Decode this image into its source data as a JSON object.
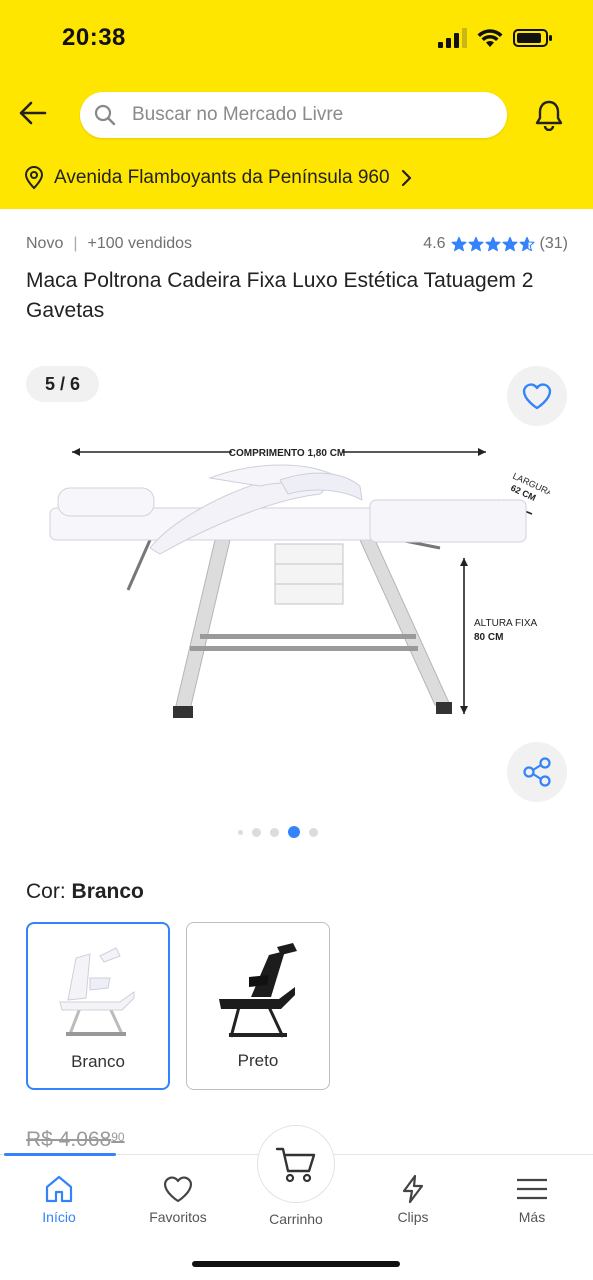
{
  "status_bar": {
    "time": "20:38"
  },
  "search": {
    "placeholder": "Buscar no Mercado Livre"
  },
  "address": {
    "text": "Avenida Flamboyants da Península 960"
  },
  "product": {
    "condition": "Novo",
    "sold": "+100 vendidos",
    "rating": "4.6",
    "rating_stars": 4.6,
    "review_count": "(31)",
    "title": "Maca Poltrona Cadeira Fixa Luxo Estética Tatuagem 2 Gavetas",
    "old_price": "R$ 4.068",
    "old_price_cents": "90"
  },
  "gallery": {
    "counter": "5 / 6",
    "image_labels": {
      "length": "COMPRIMENTO 1,80 CM",
      "width_label": "LARGURA",
      "width_value": "62 CM",
      "height_label": "ALTURA FIXA",
      "height_value": "80 CM"
    }
  },
  "color_selector": {
    "label": "Cor:",
    "selected": "Branco",
    "options": [
      {
        "label": "Branco"
      },
      {
        "label": "Preto"
      }
    ]
  },
  "bottom_nav": {
    "items": [
      {
        "label": "Início",
        "icon": "home-icon"
      },
      {
        "label": "Favoritos",
        "icon": "heart-icon"
      },
      {
        "label": "Carrinho",
        "icon": "cart-icon"
      },
      {
        "label": "Clips",
        "icon": "lightning-icon"
      },
      {
        "label": "Más",
        "icon": "menu-icon"
      }
    ]
  },
  "colors": {
    "header_yellow": "#FFE600",
    "accent_blue": "#3483FA"
  }
}
